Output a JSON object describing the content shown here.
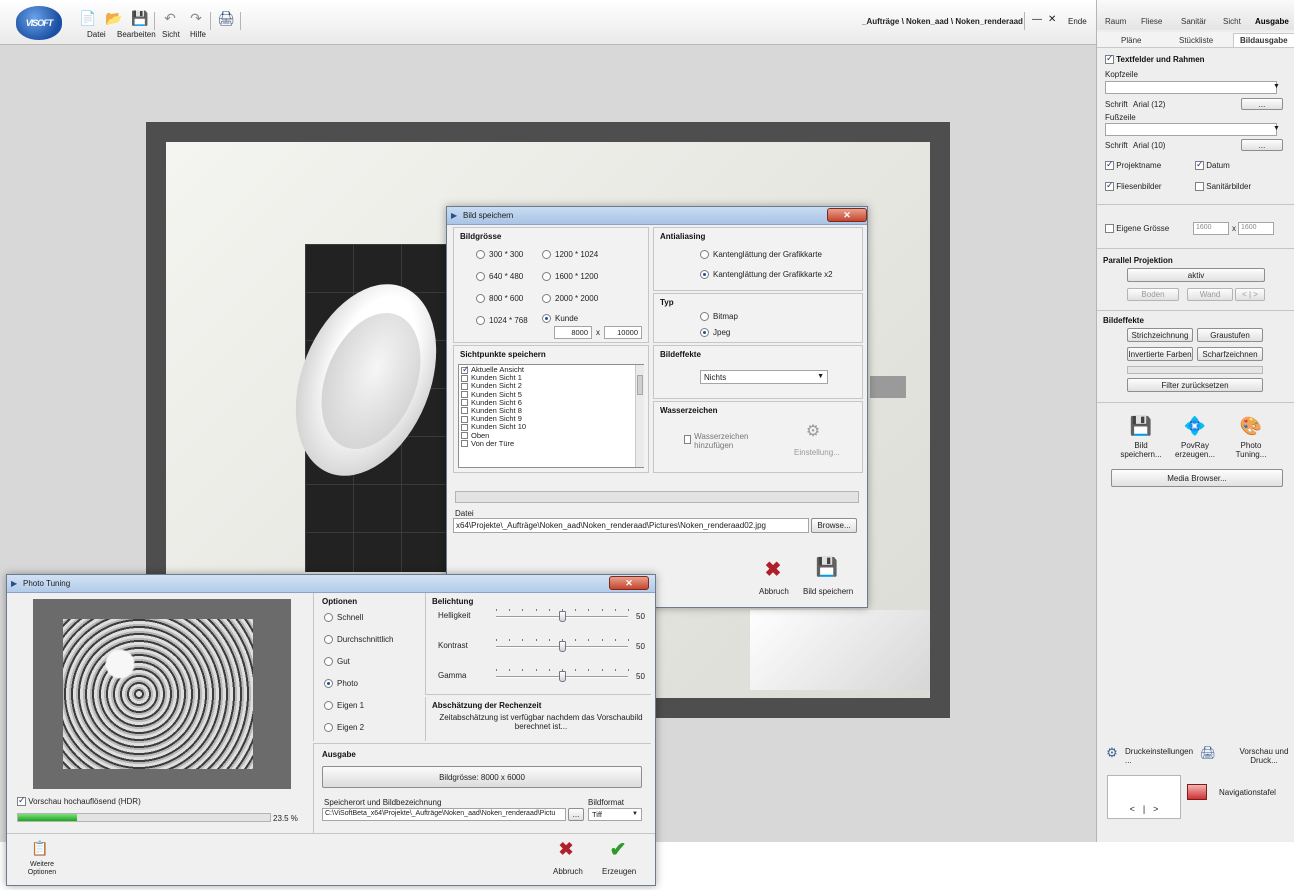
{
  "app": {
    "logo": "VISOFT",
    "menu": [
      "Datei",
      "Bearbeiten",
      "Sicht",
      "Hilfe"
    ],
    "path": "_Aufträge \\ Noken_aad \\ Noken_renderaad",
    "window_minimize": "—",
    "window_close": "✕",
    "window_end": "Ende",
    "toolbar_icons": [
      "new-icon",
      "open-icon",
      "save-icon",
      "undo-icon",
      "redo-icon",
      "print-icon"
    ]
  },
  "right_panel": {
    "tabs": [
      "Raum",
      "Fliese",
      "Sanitär",
      "Sicht",
      "Ausgabe"
    ],
    "active_tab": "Ausgabe",
    "subtabs": [
      "Pläne",
      "Stückliste",
      "Bildausgabe"
    ],
    "active_subtab": "Bildausgabe",
    "textfields": {
      "title": "Textfelder und Rahmen",
      "checked": true,
      "header_label": "Kopfzeile",
      "header_font_label": "Schrift",
      "header_font_value": "Arial (12)",
      "footer_label": "Fußzeile",
      "footer_font_label": "Schrift",
      "footer_font_value": "Arial (10)",
      "ellipsis": "...",
      "checks": [
        {
          "label": "Projektname",
          "checked": true
        },
        {
          "label": "Datum",
          "checked": true
        },
        {
          "label": "Fliesenbilder",
          "checked": true
        },
        {
          "label": "Sanitärbilder",
          "checked": false
        }
      ]
    },
    "own_size": {
      "label": "Eigene Grösse",
      "checked": false,
      "width": "1600",
      "x": "x",
      "height": "1600"
    },
    "parallel": {
      "title": "Parallel Projektion",
      "aktiv": "aktiv",
      "boden": "Boden",
      "wand": "Wand",
      "prev": "<",
      "sep": "|",
      "next": ">"
    },
    "effects": {
      "title": "Bildeffekte",
      "buttons": [
        "Strichzeichnung",
        "Graustufen",
        "Invertierte Farben",
        "Scharfzeichnen"
      ],
      "reset": "Filter zurücksetzen"
    },
    "actions": [
      {
        "label": "Bild speichern...",
        "icon": "save-image-icon"
      },
      {
        "label": "PovRay erzeugen...",
        "icon": "povray-icon"
      },
      {
        "label": "Photo Tuning...",
        "icon": "photo-tuning-icon"
      }
    ],
    "media_browser": "Media Browser...",
    "print_settings": "Druckeinstellungen ...",
    "preview_print": "Vorschau und Druck...",
    "nav": {
      "prev": "<",
      "sep": "|",
      "next": ">",
      "label": "Navigationstafel"
    }
  },
  "save_dialog": {
    "title": "Bild speichern",
    "close": "✕",
    "bildgroesse": {
      "title": "Bildgrösse",
      "options": [
        {
          "label": "300 * 300",
          "selected": false
        },
        {
          "label": "1200 * 1024",
          "selected": false
        },
        {
          "label": "640 * 480",
          "selected": false
        },
        {
          "label": "1600 * 1200",
          "selected": false
        },
        {
          "label": "800 * 600",
          "selected": false
        },
        {
          "label": "2000 * 2000",
          "selected": false
        },
        {
          "label": "1024 * 768",
          "selected": false
        },
        {
          "label": "Kunde",
          "selected": true
        }
      ],
      "custom_w": "8000",
      "custom_x": "x",
      "custom_h": "10000"
    },
    "antialiasing": {
      "title": "Antialiasing",
      "options": [
        {
          "label": "Kantenglättung der Grafikkarte",
          "selected": false
        },
        {
          "label": "Kantenglättung der Grafikkarte x2",
          "selected": true
        }
      ]
    },
    "typ": {
      "title": "Typ",
      "options": [
        {
          "label": "Bitmap",
          "selected": false
        },
        {
          "label": "Jpeg",
          "selected": true
        }
      ]
    },
    "sichtpunkte": {
      "title": "Sichtpunkte speichern",
      "items": [
        {
          "label": "Aktuelle Ansicht",
          "checked": true
        },
        {
          "label": "Kunden Sicht 1",
          "checked": false
        },
        {
          "label": "Kunden Sicht 2",
          "checked": false
        },
        {
          "label": "Kunden Sicht 5",
          "checked": false
        },
        {
          "label": "Kunden Sicht 6",
          "checked": false
        },
        {
          "label": "Kunden Sicht 8",
          "checked": false
        },
        {
          "label": "Kunden Sicht 9",
          "checked": false
        },
        {
          "label": "Kunden Sicht 10",
          "checked": false
        },
        {
          "label": "Oben",
          "checked": false
        },
        {
          "label": "Von der Türe",
          "checked": false
        }
      ]
    },
    "bildeffekte": {
      "title": "Bildeffekte",
      "value": "Nichts"
    },
    "wasserzeichen": {
      "title": "Wasserzeichen",
      "checkbox": "Wasserzeichen hinzufügen",
      "settings": "Einstellung..."
    },
    "datei_label": "Datei",
    "datei_value": "x64\\Projekte\\_Aufträge\\Noken_aad\\Noken_renderaad\\Pictures\\Noken_renderaad02.jpg",
    "browse": "Browse...",
    "cancel": "Abbruch",
    "save": "Bild speichern"
  },
  "photo_tuning": {
    "title": "Photo Tuning",
    "close": "✕",
    "hdr": {
      "label": "Vorschau hochauflösend (HDR)",
      "checked": true
    },
    "progress_percent": "23.5 %",
    "progress_value": 23.5,
    "optionen": {
      "title": "Optionen",
      "options": [
        {
          "label": "Schnell",
          "selected": false
        },
        {
          "label": "Durchschnittlich",
          "selected": false
        },
        {
          "label": "Gut",
          "selected": false
        },
        {
          "label": "Photo",
          "selected": true
        },
        {
          "label": "Eigen 1",
          "selected": false
        },
        {
          "label": "Eigen 2",
          "selected": false
        }
      ]
    },
    "belichtung": {
      "title": "Belichtung",
      "sliders": [
        {
          "label": "Helligkeit",
          "value": 50
        },
        {
          "label": "Kontrast",
          "value": 50
        },
        {
          "label": "Gamma",
          "value": 50
        }
      ]
    },
    "abschaetzung": {
      "title": "Abschätzung der Rechenzeit",
      "text": "Zeitabschätzung ist verfügbar nachdem das Vorschaubild berechnet ist..."
    },
    "ausgabe": {
      "title": "Ausgabe",
      "size_button": "Bildgrösse: 8000 x 6000"
    },
    "speicherort_label": "Speicherort und Bildbezeichnung",
    "speicherort_value": "C:\\ViSoftBeta_x64\\Projekte\\_Aufträge\\Noken_aad\\Noken_renderaad\\Pictu",
    "browse": "...",
    "format_label": "Bildformat",
    "format_value": "Tiff",
    "more_options": "Weitere Optionen",
    "cancel": "Abbruch",
    "create": "Erzeugen"
  },
  "colors": {
    "progress": "#1fa31f",
    "cancel_x": "#b0202a",
    "ok_check": "#2a9a2a",
    "title_bar": "#a9c4e6"
  }
}
